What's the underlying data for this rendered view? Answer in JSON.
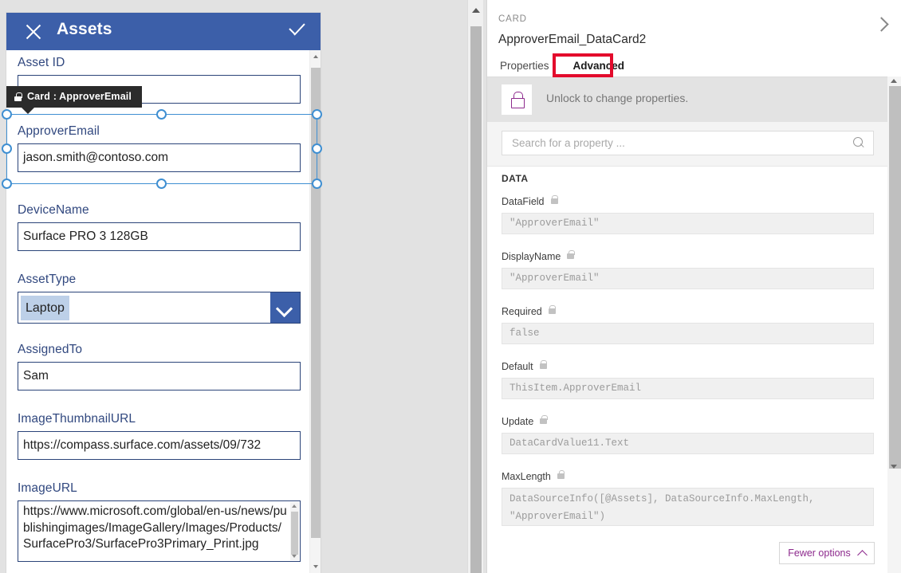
{
  "app": {
    "title": "Assets",
    "close_icon": "close-icon",
    "confirm_icon": "checkmark-icon"
  },
  "form": {
    "fields": [
      {
        "label": "Asset ID",
        "value": "",
        "type": "text"
      },
      {
        "label": "ApproverEmail",
        "value": "jason.smith@contoso.com",
        "type": "text"
      },
      {
        "label": "DeviceName",
        "value": "Surface PRO 3 128GB",
        "type": "text"
      },
      {
        "label": "AssetType",
        "value": "Laptop",
        "type": "dropdown"
      },
      {
        "label": "AssignedTo",
        "value": "Sam",
        "type": "text"
      },
      {
        "label": "ImageThumbnailURL",
        "value": "https://compass.surface.com/assets/09/732",
        "type": "text"
      },
      {
        "label": "ImageURL",
        "value": "https://www.microsoft.com/global/en-us/news/publishingimages/ImageGallery/Images/Products/SurfacePro3/SurfacePro3Primary_Print.jpg",
        "type": "multiline"
      }
    ]
  },
  "tooltip": {
    "text": "Card : ApproverEmail",
    "lock_icon": "lock-icon"
  },
  "panel": {
    "kicker": "CARD",
    "name": "ApproverEmail_DataCard2",
    "collapse_icon": "chevron-right-icon",
    "tabs": [
      {
        "label": "Properties",
        "active": false
      },
      {
        "label": "Advanced",
        "active": true
      }
    ],
    "highlight_color": "#e30b2c",
    "unlock": {
      "text": "Unlock to change properties.",
      "icon": "lock-icon",
      "icon_color": "#8d2a8d"
    },
    "search": {
      "placeholder": "Search for a property ...",
      "value": "",
      "icon": "search-icon"
    },
    "section_title": "DATA",
    "properties": [
      {
        "label": "DataField",
        "value": "\"ApproverEmail\"",
        "locked": true,
        "tall": false
      },
      {
        "label": "DisplayName",
        "value": "\"ApproverEmail\"",
        "locked": true,
        "tall": false
      },
      {
        "label": "Required",
        "value": "false",
        "locked": true,
        "tall": false
      },
      {
        "label": "Default",
        "value": "ThisItem.ApproverEmail",
        "locked": true,
        "tall": false
      },
      {
        "label": "Update",
        "value": "DataCardValue11.Text",
        "locked": true,
        "tall": false
      },
      {
        "label": "MaxLength",
        "value": "DataSourceInfo([@Assets], DataSourceInfo.MaxLength, \"ApproverEmail\")",
        "locked": true,
        "tall": true
      }
    ],
    "fewer_options": {
      "label": "Fewer options",
      "icon": "chevron-up-icon",
      "color": "#8d2a8d"
    }
  },
  "theme": {
    "header_blue": "#3c5fa9",
    "label_blue": "#31487f",
    "border_navy": "#2b4479",
    "selection_blue": "#3f8fd2",
    "canvas_gray": "#e2e2e2"
  }
}
